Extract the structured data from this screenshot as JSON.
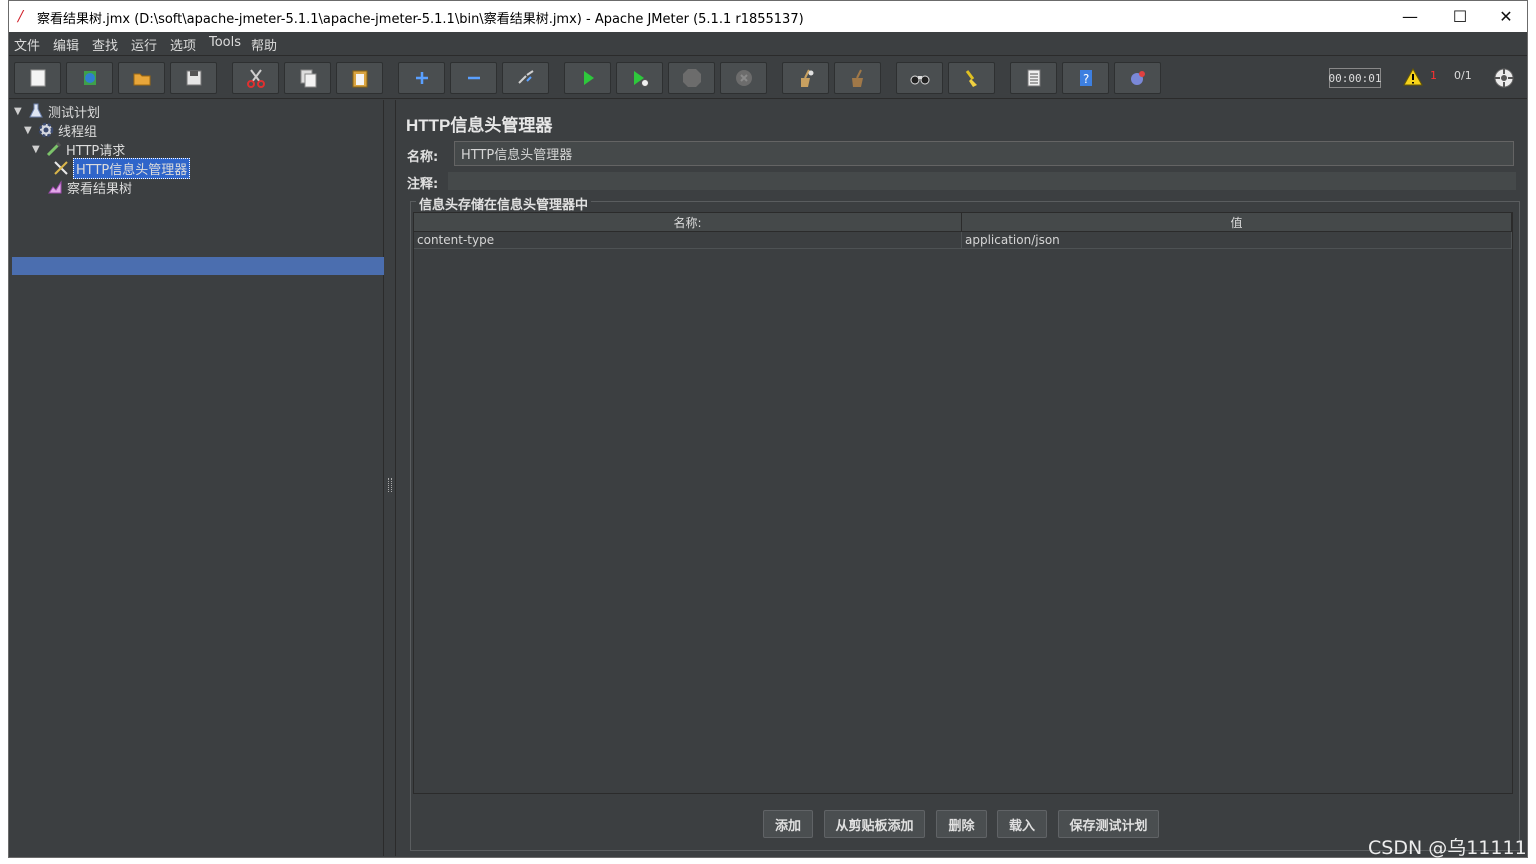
{
  "window": {
    "title": "察看结果树.jmx (D:\\soft\\apache-jmeter-5.1.1\\apache-jmeter-5.1.1\\bin\\察看结果树.jmx) - Apache JMeter (5.1.1 r1855137)",
    "minimize": "—",
    "maximize": "☐",
    "close": "✕"
  },
  "menu": [
    "文件",
    "编辑",
    "查找",
    "运行",
    "选项",
    "Tools",
    "帮助"
  ],
  "toolbar": {
    "buttons": [
      "new",
      "templates",
      "open",
      "save",
      "cut",
      "copy",
      "paste",
      "expand",
      "collapse",
      "toggle",
      "start",
      "start-no-pause",
      "stop",
      "shutdown",
      "clear",
      "clear-all",
      "search",
      "reset-search",
      "function-helper",
      "help",
      "remote"
    ],
    "timer": "00:00:01",
    "warnings": "1",
    "threads": "0/1"
  },
  "tree": {
    "nodes": [
      {
        "label": "测试计划",
        "icon": "flask-icon",
        "expanded": true
      },
      {
        "label": "线程组",
        "icon": "gear-icon",
        "expanded": true
      },
      {
        "label": "HTTP请求",
        "icon": "pipette-icon",
        "expanded": true
      },
      {
        "label": "HTTP信息头管理器",
        "icon": "tools-icon",
        "selected": true
      },
      {
        "label": "察看结果树",
        "icon": "chart-icon"
      }
    ]
  },
  "panel": {
    "title": "HTTP信息头管理器",
    "name_label": "名称:",
    "name_value": "HTTP信息头管理器",
    "comment_label": "注释:",
    "group_title": "信息头存储在信息头管理器中",
    "table": {
      "headers": [
        "名称:",
        "值"
      ],
      "rows": [
        [
          "content-type",
          "application/json"
        ]
      ]
    },
    "buttons": [
      "添加",
      "从剪贴板添加",
      "删除",
      "载入",
      "保存测试计划"
    ]
  },
  "watermark": "CSDN @乌11111",
  "colors": {
    "background": "#3c3f41",
    "selection": "#4b6eaf",
    "warning": "#ff3030"
  }
}
